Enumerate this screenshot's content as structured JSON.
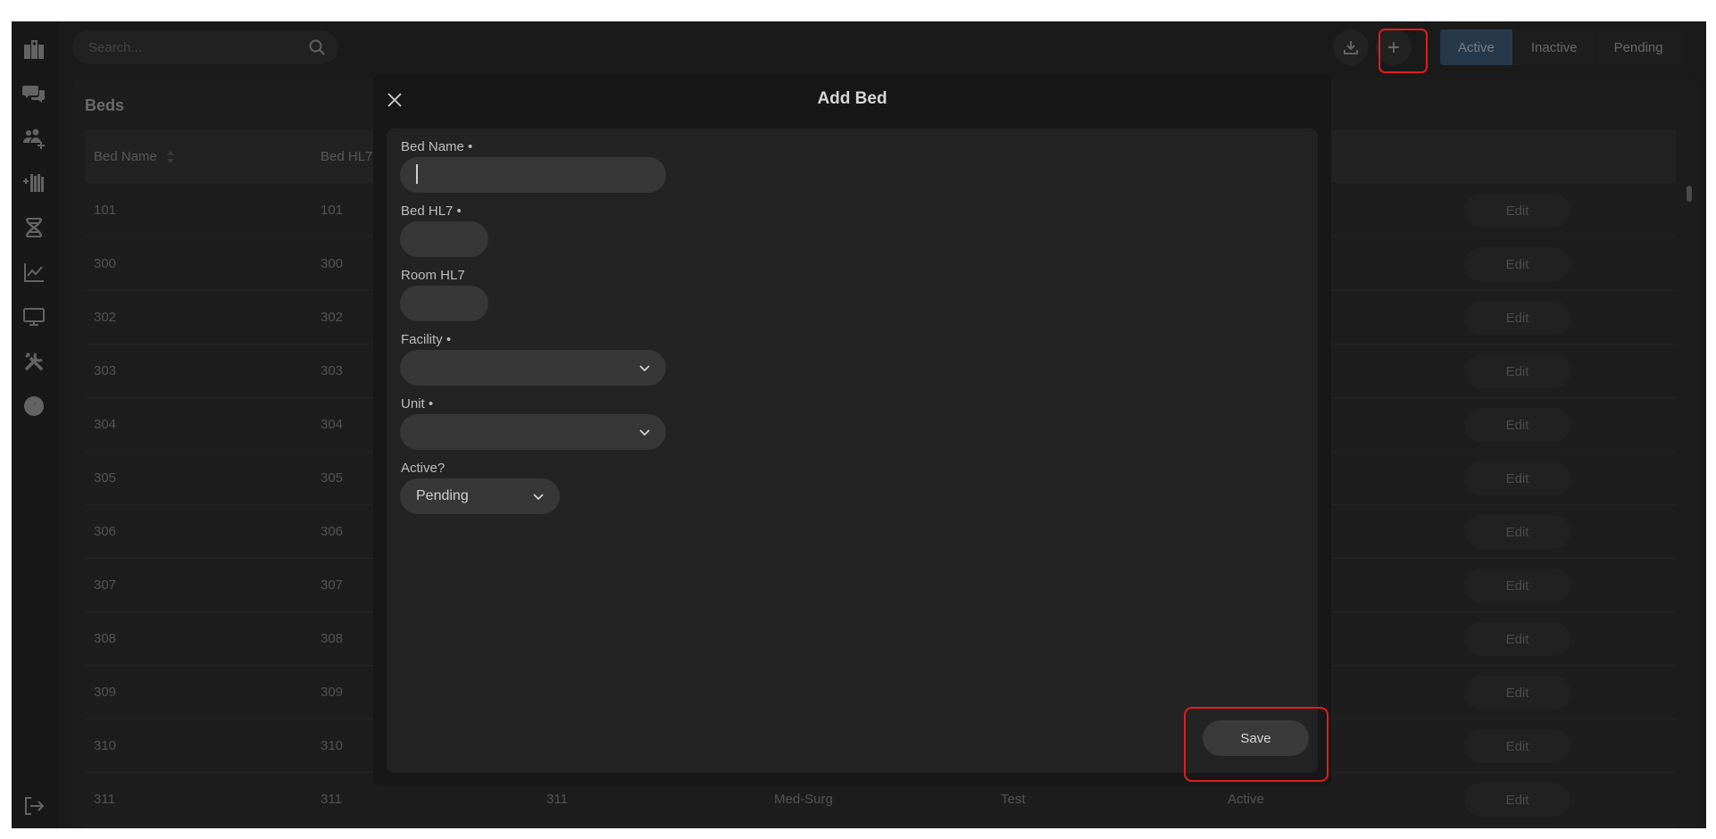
{
  "search": {
    "placeholder": "Search..."
  },
  "header": {
    "status_tabs": [
      "Active",
      "Inactive",
      "Pending"
    ],
    "active_tab": "Active"
  },
  "sidebar": {
    "items": [
      {
        "icon": "hospital-icon"
      },
      {
        "icon": "chat-icon"
      },
      {
        "icon": "add-users-icon"
      },
      {
        "icon": "add-beds-icon"
      },
      {
        "icon": "dna-icon"
      },
      {
        "icon": "chart-line-icon"
      },
      {
        "icon": "monitor-icon"
      },
      {
        "icon": "tools-icon"
      },
      {
        "icon": "help-icon"
      },
      {
        "icon": "logout-icon"
      }
    ]
  },
  "table": {
    "title": "Beds",
    "columns": [
      "Bed Name",
      "Bed HL7"
    ],
    "edit_label": "Edit",
    "rows": [
      {
        "name": "101",
        "hl7": "101"
      },
      {
        "name": "300",
        "hl7": "300"
      },
      {
        "name": "302",
        "hl7": "302"
      },
      {
        "name": "303",
        "hl7": "303"
      },
      {
        "name": "304",
        "hl7": "304"
      },
      {
        "name": "305",
        "hl7": "305"
      },
      {
        "name": "306",
        "hl7": "306"
      },
      {
        "name": "307",
        "hl7": "307"
      },
      {
        "name": "308",
        "hl7": "308"
      },
      {
        "name": "309",
        "hl7": "309"
      },
      {
        "name": "310",
        "hl7": "310"
      },
      {
        "name": "311",
        "hl7": "311",
        "room": "311",
        "unit": "Med-Surg",
        "facility": "Test",
        "status": "Active"
      }
    ]
  },
  "modal": {
    "title": "Add Bed",
    "fields": {
      "bed_name": {
        "label": "Bed Name •",
        "value": ""
      },
      "bed_hl7": {
        "label": "Bed HL7 •",
        "value": ""
      },
      "room_hl7": {
        "label": "Room HL7",
        "value": ""
      },
      "facility": {
        "label": "Facility •",
        "value": ""
      },
      "unit": {
        "label": "Unit •",
        "value": ""
      },
      "active": {
        "label": "Active?",
        "value": "Pending"
      }
    },
    "save_label": "Save"
  },
  "colors": {
    "accent": "#44678a",
    "highlight": "#e11d1d",
    "background": "#2b2b2b"
  }
}
